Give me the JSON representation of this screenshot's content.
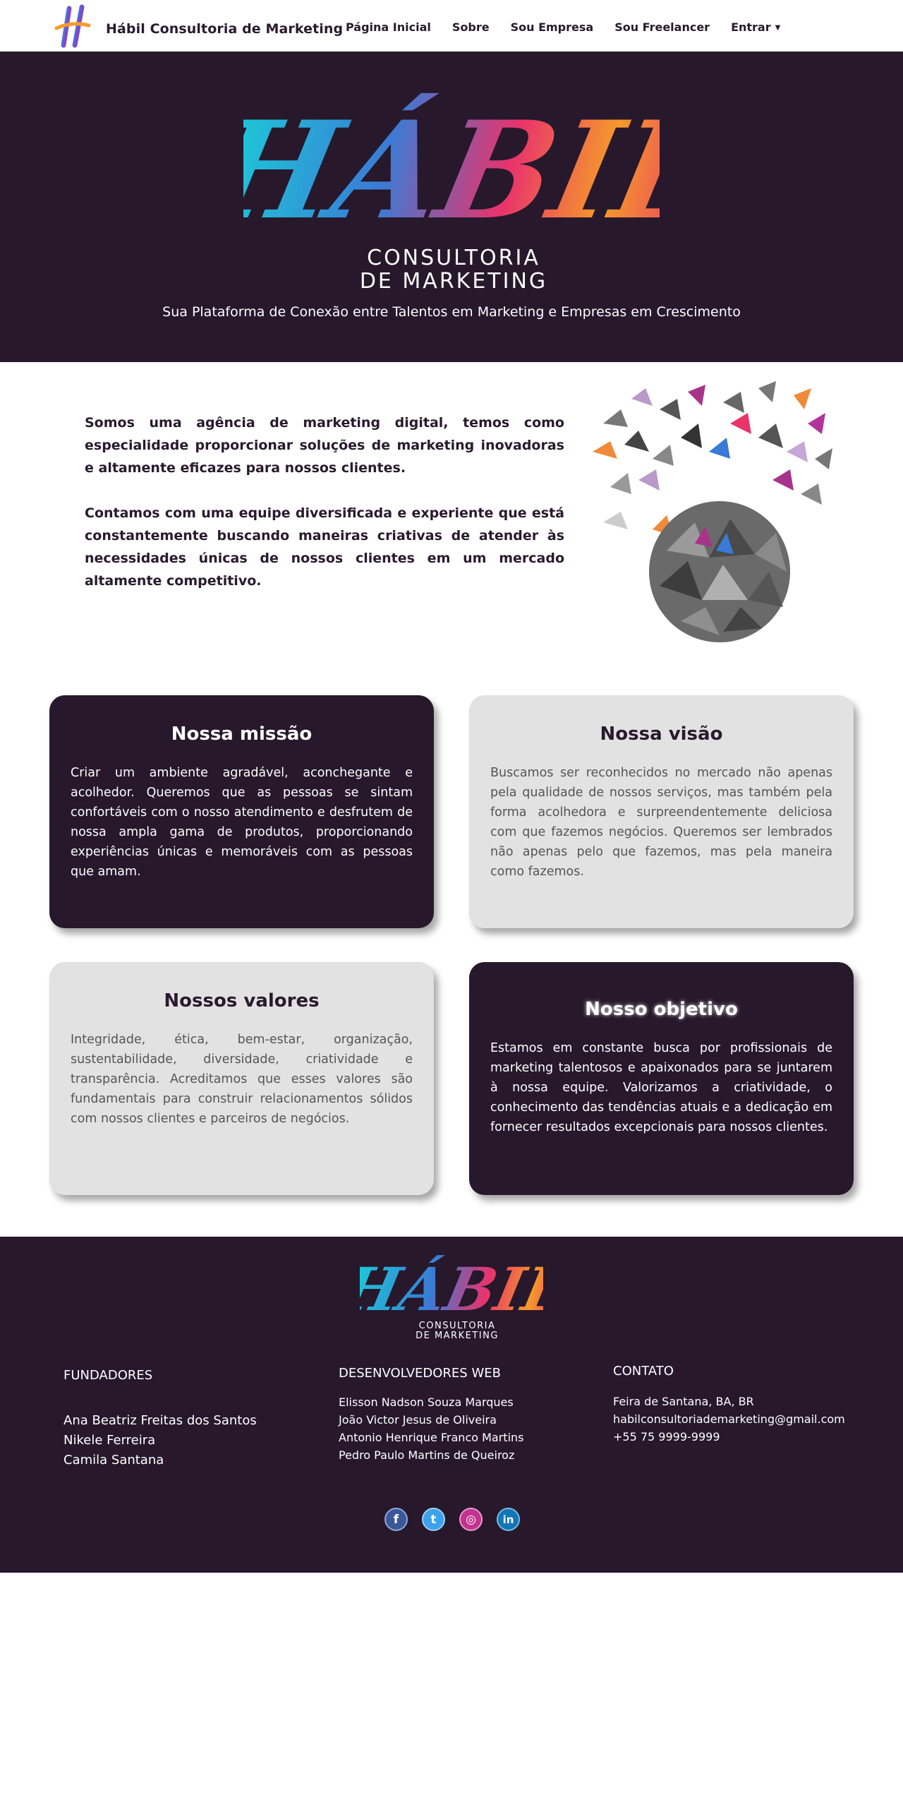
{
  "nav": {
    "brand": "Hábil Consultoria de Marketing",
    "items": [
      {
        "label": "Página Inicial"
      },
      {
        "label": "Sobre"
      },
      {
        "label": "Sou Empresa"
      },
      {
        "label": "Sou Freelancer"
      },
      {
        "label": "Entrar"
      }
    ],
    "caret": "▼"
  },
  "hero": {
    "logo_title": "HÁBIL",
    "logo_sub1": "CONSULTORIA",
    "logo_sub2": "DE MARKETING",
    "tagline": "Sua Plataforma de Conexão entre Talentos em Marketing e Empresas em Crescimento"
  },
  "about": {
    "p1": "Somos uma agência de marketing digital, temos como especialidade proporcionar soluções de marketing inovadoras e altamente eficazes para nossos clientes.",
    "p2": "Contamos com uma equipe diversificada e experiente que está constantemente buscando maneiras criativas de atender às necessidades únicas de nossos clientes em um mercado altamente competitivo."
  },
  "cards": {
    "missao": {
      "title": "Nossa missão",
      "text": "Criar um ambiente agradável, aconchegante e acolhedor. Queremos que as pessoas se sintam confortáveis com o nosso atendimento e desfrutem de nossa ampla gama de produtos, proporcionando experiências únicas e memoráveis com as pessoas que amam."
    },
    "visao": {
      "title": "Nossa visão",
      "text": "Buscamos ser reconhecidos no mercado não apenas pela qualidade de nossos serviços, mas também pela forma acolhedora e surpreendentemente deliciosa com que fazemos negócios. Queremos ser lembrados não apenas pelo que fazemos, mas pela maneira como fazemos."
    },
    "valores": {
      "title": "Nossos valores",
      "text": "Integridade, ética, bem-estar, organização, sustentabilidade, diversidade, criatividade e transparência. Acreditamos que esses valores são fundamentais para construir relacionamentos sólidos com nossos clientes e parceiros de negócios."
    },
    "objetivo": {
      "title": "Nosso objetivo",
      "text": "Estamos em constante busca por profissionais de marketing talentosos e apaixonados para se juntarem à nossa equipe. Valorizamos a criatividade, o conhecimento das tendências atuais e a dedicação em fornecer resultados excepcionais para nossos clientes."
    }
  },
  "footer": {
    "logo_title": "HÁBIL",
    "logo_sub1": "CONSULTORIA",
    "logo_sub2": "DE MARKETING",
    "fundadores": {
      "title": "FUNDADORES",
      "names": [
        "Ana Beatriz Freitas dos Santos",
        "Nikele Ferreira",
        "Camila Santana"
      ]
    },
    "devs": {
      "title": "DESENVOLVEDORES WEB",
      "names": [
        "Elisson Nadson Souza Marques",
        "João Victor Jesus de Oliveira",
        "Antonio Henrique Franco Martins",
        "Pedro Paulo Martins de Queiroz"
      ]
    },
    "contato": {
      "title": "CONTATO",
      "lines": [
        "Feira de Santana, BA, BR",
        "habilconsultoriademarketing@gmail.com",
        " +55 75 9999-9999"
      ]
    },
    "socials": [
      {
        "icon": "facebook-icon",
        "glyph": "f"
      },
      {
        "icon": "twitter-icon",
        "glyph": "t"
      },
      {
        "icon": "instagram-icon",
        "glyph": "◎"
      },
      {
        "icon": "linkedin-icon",
        "glyph": "in"
      }
    ]
  },
  "colors": {
    "primary_dark": "#27182c",
    "card_light": "#e2e2e2",
    "accent_cyan": "#1ad1d8",
    "accent_pink": "#e9336b",
    "accent_orange": "#f59a2a"
  }
}
